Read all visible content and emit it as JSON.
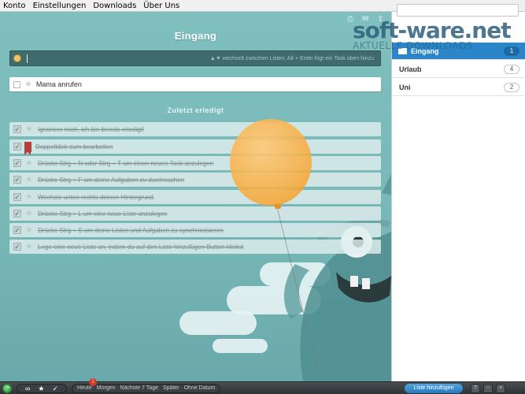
{
  "menu": [
    "Konto",
    "Einstellungen",
    "Downloads",
    "Über Uns"
  ],
  "main": {
    "title": "Eingang",
    "add_task_hint": "▲▼ wechselt zwischen Listen, Alt + Enter fügt ein Task oben hinzu",
    "open_tasks": [
      {
        "label": "Mama anrufen"
      }
    ],
    "done_header": "Zuletzt erledigt",
    "done_tasks": [
      {
        "label": "Ignoriere mich, ich bin bereits erledigt!"
      },
      {
        "label": "Doppelklick zum bearbeiten"
      },
      {
        "label": "Drücke Strg + N oder Strg + T um einen neuen Task anzulegen"
      },
      {
        "label": "Drücke Strg + F um deine Aufgaben zu durchsuchen"
      },
      {
        "label": "Wechsle unten rechts deinen Hintergrund"
      },
      {
        "label": "Drücke Strg + L um eine neue Liste anzulegen"
      },
      {
        "label": "Drücke Strg + S um deine Listen und Aufgaben zu synchronisieren"
      },
      {
        "label": "Lege eine neue Liste an, indem du auf den Liste hinzufügen Button klickst"
      }
    ]
  },
  "sidebar": {
    "lists": [
      {
        "name": "Eingang",
        "count": "1",
        "active": true
      },
      {
        "name": "Urlaub",
        "count": "4",
        "active": false
      },
      {
        "name": "Uni",
        "count": "2",
        "active": false
      }
    ]
  },
  "watermark": {
    "main": "soft-ware.net",
    "sub": "AKTUELLE DOWNLOADS"
  },
  "bottombar": {
    "filters": [
      "Heute",
      "Morgen",
      "Nächste 7 Tage",
      "Später",
      "Ohne Datum"
    ],
    "badge": "1",
    "add_list_label": "Liste hinzufügen",
    "icons": [
      "infinity-icon",
      "star-icon",
      "check-icon"
    ],
    "right_icons": [
      "?",
      "-",
      "+"
    ]
  },
  "colors": {
    "accent": "#2a86c8",
    "background": "#7fbcbb",
    "balloon": "#f7a93a"
  }
}
